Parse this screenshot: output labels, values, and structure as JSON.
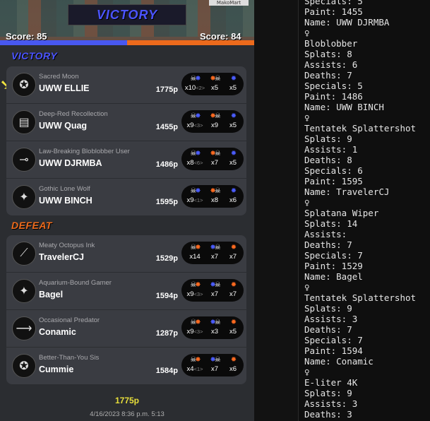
{
  "header": {
    "banner_title": "VICTORY",
    "sign_text": "MakoMart",
    "score_left": "Score: 85",
    "score_right": "Score: 84",
    "colors": {
      "team_blue": "#4858f0",
      "team_orange": "#ec6a1c"
    }
  },
  "winners": {
    "label": "VICTORY",
    "label_color": "#4b54ff",
    "players": [
      {
        "title": "Sacred Moon",
        "name": "UWW ELLIE",
        "paint": "1775p",
        "avatar_icon": "blaster-icon",
        "stats": {
          "kills": "x10",
          "assist": "<2>",
          "deaths": "x5",
          "specials": "x5"
        }
      },
      {
        "title": "Deep-Red Recollection",
        "name": "UWW Quag",
        "paint": "1455p",
        "avatar_icon": "bucket-icon",
        "stats": {
          "kills": "x9",
          "assist": "<3>",
          "deaths": "x9",
          "specials": "x5"
        }
      },
      {
        "title": "Law-Breaking Bloblobber User",
        "name": "UWW DJRMBA",
        "paint": "1486p",
        "avatar_icon": "bloblobber-icon",
        "stats": {
          "kills": "x8",
          "assist": "<6>",
          "deaths": "x7",
          "specials": "x5"
        }
      },
      {
        "title": "Gothic Lone Wolf",
        "name": "UWW BINCH",
        "paint": "1595p",
        "avatar_icon": "splattershot-icon",
        "stats": {
          "kills": "x9",
          "assist": "<1>",
          "deaths": "x8",
          "specials": "x6"
        }
      }
    ]
  },
  "losers": {
    "label": "DEFEAT",
    "label_color": "#ec6a1c",
    "players": [
      {
        "title": "Meaty Octopus Ink",
        "name": "TravelerCJ",
        "paint": "1529p",
        "avatar_icon": "splatana-icon",
        "stats": {
          "kills": "x14",
          "assist": "",
          "deaths": "x7",
          "specials": "x7"
        }
      },
      {
        "title": "Aquarium-Bound Gamer",
        "name": "Bagel",
        "paint": "1594p",
        "avatar_icon": "splattershot-icon",
        "stats": {
          "kills": "x9",
          "assist": "<3>",
          "deaths": "x7",
          "specials": "x7"
        }
      },
      {
        "title": "Occasional Predator",
        "name": "Conamic",
        "paint": "1287p",
        "avatar_icon": "eliter-icon",
        "stats": {
          "kills": "x9",
          "assist": "<3>",
          "deaths": "x3",
          "specials": "x5"
        }
      },
      {
        "title": "Better-Than-You Sis",
        "name": "Cummie",
        "paint": "1584p",
        "avatar_icon": "blaster-icon",
        "stats": {
          "kills": "x4",
          "assist": "<1>",
          "deaths": "x7",
          "specials": "x6"
        }
      }
    ]
  },
  "footer": {
    "paint": "1775p",
    "datetime": "4/16/2023 8:36 p.m. 5:13"
  },
  "log_lines": [
    "Specials: 5",
    "Paint: 1455",
    "Name: UWW DJRMBA",
    "♀",
    "Bloblobber",
    "Splats: 8",
    "Assists: 6",
    "Deaths: 7",
    "Specials: 5",
    "Paint: 1486",
    "Name: UWW BINCH",
    "♀",
    "Tentatek Splattershot",
    "Splats: 9",
    "Assists: 1",
    "Deaths: 8",
    "Specials: 6",
    "Paint: 1595",
    "Name: TravelerCJ",
    "♀",
    "Splatana Wiper",
    "Splats: 14",
    "Assists:",
    "Deaths: 7",
    "Specials: 7",
    "Paint: 1529",
    "Name: Bagel",
    "♀",
    "Tentatek Splattershot",
    "Splats: 9",
    "Assists: 3",
    "Deaths: 7",
    "Specials: 7",
    "Paint: 1594",
    "Name: Conamic",
    "♀",
    "E-liter 4K",
    "Splats: 9",
    "Assists: 3",
    "Deaths: 3"
  ]
}
